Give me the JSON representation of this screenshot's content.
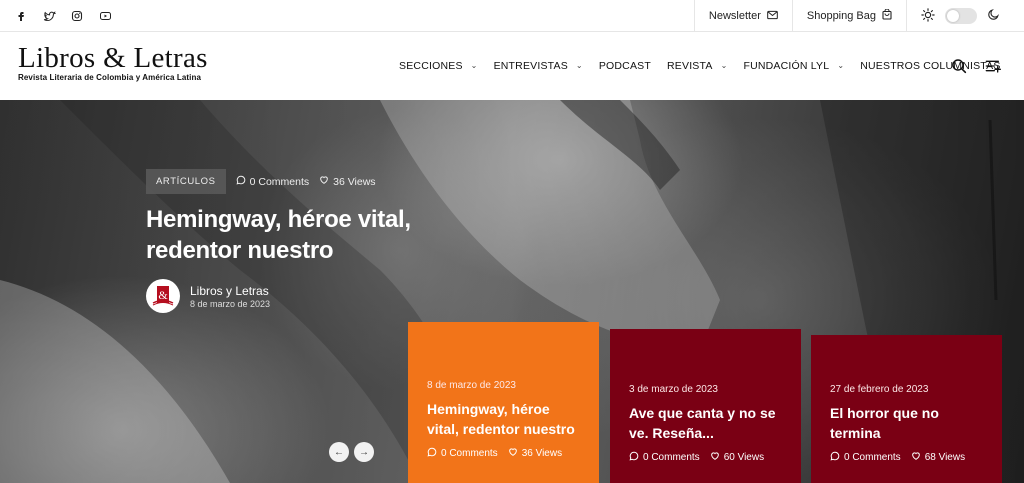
{
  "topbar": {
    "social": [
      "facebook-icon",
      "twitter-icon",
      "instagram-icon",
      "youtube-icon"
    ],
    "newsletter_label": "Newsletter",
    "shopping_bag_label": "Shopping Bag"
  },
  "header": {
    "logo_title": "Libros & Letras",
    "logo_subtitle": "Revista Literaria de Colombia y América Latina",
    "nav": [
      {
        "label": "SECCIONES",
        "dropdown": true
      },
      {
        "label": "ENTREVISTAS",
        "dropdown": true
      },
      {
        "label": "PODCAST",
        "dropdown": false
      },
      {
        "label": "REVISTA",
        "dropdown": true
      },
      {
        "label": "FUNDACIÓN LYL",
        "dropdown": true
      },
      {
        "label": "NUESTROS COLUMNISTAS",
        "dropdown": false
      }
    ]
  },
  "hero": {
    "category": "ARTÍCULOS",
    "comments": "0 Comments",
    "views": "36 Views",
    "title": "Hemingway, héroe vital, redentor nuestro",
    "author_name": "Libros y Letras",
    "author_date": "8 de marzo de 2023"
  },
  "cards": [
    {
      "date": "8 de marzo de 2023",
      "title": "Hemingway, héroe vital, redentor nuestro",
      "comments": "0 Comments",
      "views": "36 Views",
      "color": "#f27419"
    },
    {
      "date": "3 de marzo de 2023",
      "title": "Ave que canta y no se ve. Reseña...",
      "comments": "0 Comments",
      "views": "60 Views",
      "color": "#7a0014"
    },
    {
      "date": "27 de febrero de 2023",
      "title": "El horror que no termina",
      "comments": "0 Comments",
      "views": "68 Views",
      "color": "#7a0014"
    }
  ],
  "colors": {
    "accent": "#f27419",
    "card_dark": "#7a0014"
  }
}
